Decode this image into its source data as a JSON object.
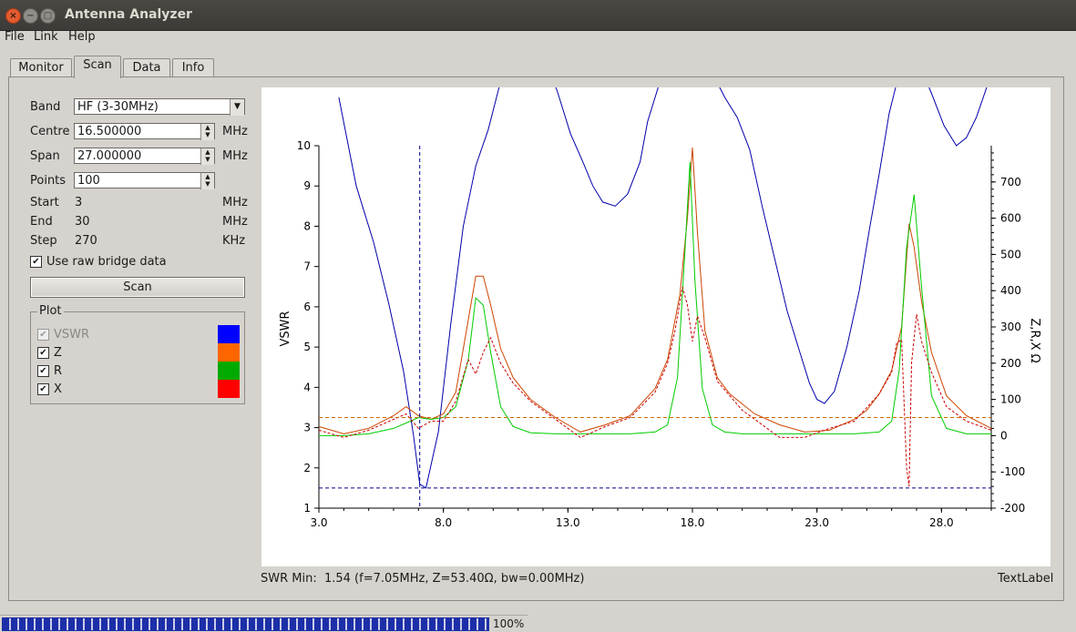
{
  "window": {
    "title": "Antenna Analyzer",
    "close_glyph": "×",
    "min_glyph": "−",
    "max_glyph": "□"
  },
  "menu": [
    "File",
    "Link",
    "Help"
  ],
  "tabs": [
    "Monitor",
    "Scan",
    "Data",
    "Info"
  ],
  "active_tab": "Scan",
  "form": {
    "band_label": "Band",
    "band_value": "HF (3-30MHz)",
    "centre_label": "Centre",
    "centre_value": "16.500000",
    "centre_unit": "MHz",
    "span_label": "Span",
    "span_value": "27.000000",
    "span_unit": "MHz",
    "points_label": "Points",
    "points_value": "100",
    "start_label": "Start",
    "start_value": "3",
    "start_unit": "MHz",
    "end_label": "End",
    "end_value": "30",
    "end_unit": "MHz",
    "step_label": "Step",
    "step_value": "270",
    "step_unit": "KHz",
    "raw_label": "Use raw bridge data",
    "raw_checked": true,
    "scan_button": "Scan"
  },
  "plot_group": {
    "title": "Plot",
    "items": [
      {
        "label": "VSWR",
        "checked": true,
        "disabled": true,
        "color": "#0000ff"
      },
      {
        "label": "Z",
        "checked": true,
        "disabled": false,
        "color": "#ff6600"
      },
      {
        "label": "R",
        "checked": true,
        "disabled": false,
        "color": "#00aa00"
      },
      {
        "label": "X",
        "checked": true,
        "disabled": false,
        "color": "#ff0000"
      }
    ]
  },
  "chart_data": {
    "type": "line",
    "xlabel": "",
    "ylabel_left": "VSWR",
    "ylabel_right": "Z,R,X Ω",
    "xlim": [
      3,
      30
    ],
    "ylim_left": [
      1,
      10
    ],
    "ylim_right": [
      -200,
      800
    ],
    "x_ticks": [
      "3.0",
      "8.0",
      "13.0",
      "18.0",
      "23.0",
      "28.0"
    ],
    "y_left_ticks": [
      "1",
      "2",
      "3",
      "4",
      "5",
      "6",
      "7",
      "8",
      "9",
      "10"
    ],
    "y_right_ticks": [
      "-200",
      "-100",
      "0",
      "100",
      "200",
      "300",
      "400",
      "500",
      "600",
      "700"
    ],
    "series": [
      {
        "name": "VSWR",
        "axis": "left",
        "color": "#0000aa",
        "dash": false,
        "x": [
          3.8,
          4.5,
          5.2,
          5.8,
          6.4,
          6.8,
          7.05,
          7.3,
          7.8,
          8.3,
          8.8,
          9.3,
          9.8,
          10.3,
          10.8,
          11.3,
          11.7,
          12.2,
          12.6,
          13.1,
          13.6,
          14.0,
          14.4,
          14.9,
          15.4,
          15.9,
          16.2,
          16.8,
          17.4,
          17.9,
          18.3,
          18.8,
          19.3,
          19.8,
          20.3,
          20.8,
          21.3,
          21.8,
          22.3,
          22.7,
          23.0,
          23.3,
          23.7,
          24.2,
          24.7,
          25.1,
          25.5,
          25.9,
          26.3,
          26.8,
          27.2,
          27.6,
          28.1,
          28.6,
          29.0,
          29.4,
          29.9
        ],
        "y": [
          11.2,
          9.0,
          7.6,
          6.1,
          4.4,
          2.8,
          1.6,
          1.5,
          2.9,
          5.6,
          8.0,
          9.5,
          10.4,
          11.6,
          12.3,
          12.6,
          12.4,
          12.0,
          11.3,
          10.3,
          9.6,
          9.0,
          8.6,
          8.5,
          8.8,
          9.6,
          10.6,
          11.8,
          12.3,
          12.5,
          12.4,
          11.8,
          11.2,
          10.7,
          9.9,
          8.5,
          7.2,
          5.9,
          4.9,
          4.1,
          3.7,
          3.6,
          3.9,
          5.0,
          6.4,
          7.9,
          9.3,
          10.8,
          11.8,
          12.2,
          11.9,
          11.3,
          10.5,
          10.0,
          10.2,
          10.7,
          11.6
        ]
      },
      {
        "name": "Z",
        "axis": "right",
        "color": "#cc4400",
        "dash": false,
        "x": [
          3.0,
          4.0,
          5.0,
          6.0,
          6.5,
          7.0,
          7.5,
          8.0,
          8.5,
          9.0,
          9.3,
          9.6,
          9.9,
          10.3,
          10.8,
          11.5,
          12.5,
          13.5,
          14.5,
          15.5,
          16.5,
          17.0,
          17.5,
          17.8,
          18.0,
          18.2,
          18.5,
          19.0,
          19.5,
          20.5,
          21.5,
          22.5,
          23.5,
          24.5,
          25.0,
          25.5,
          26.0,
          26.4,
          26.7,
          26.9,
          27.2,
          27.6,
          28.2,
          29.0,
          30.0
        ],
        "y": [
          25,
          5,
          20,
          55,
          80,
          55,
          45,
          60,
          120,
          320,
          440,
          440,
          360,
          240,
          160,
          100,
          50,
          10,
          30,
          55,
          130,
          210,
          390,
          600,
          795,
          560,
          290,
          160,
          115,
          60,
          30,
          10,
          15,
          45,
          70,
          115,
          180,
          300,
          585,
          520,
          370,
          230,
          110,
          55,
          20
        ]
      },
      {
        "name": "R",
        "axis": "right",
        "color": "#00cc00",
        "dash": false,
        "x": [
          3.0,
          4.0,
          5.0,
          6.0,
          6.5,
          7.0,
          7.5,
          8.0,
          8.5,
          9.0,
          9.3,
          9.6,
          9.9,
          10.3,
          10.8,
          11.5,
          12.5,
          13.5,
          14.5,
          15.5,
          16.5,
          17.0,
          17.4,
          17.7,
          17.9,
          18.1,
          18.4,
          18.8,
          19.3,
          20.0,
          21.5,
          22.5,
          23.5,
          24.5,
          25.5,
          26.0,
          26.3,
          26.6,
          26.9,
          27.2,
          27.6,
          28.2,
          29.0,
          30.0
        ],
        "y": [
          0,
          0,
          5,
          20,
          35,
          50,
          45,
          50,
          80,
          210,
          380,
          360,
          230,
          80,
          25,
          8,
          5,
          5,
          5,
          5,
          10,
          30,
          160,
          510,
          755,
          430,
          130,
          30,
          10,
          5,
          5,
          5,
          5,
          5,
          10,
          40,
          180,
          520,
          665,
          410,
          110,
          20,
          5,
          5
        ]
      },
      {
        "name": "X",
        "axis": "right",
        "color": "#cc0000",
        "dash": true,
        "x": [
          3.0,
          4.0,
          5.0,
          6.0,
          6.5,
          7.0,
          7.5,
          8.0,
          8.5,
          9.0,
          9.3,
          9.6,
          9.9,
          10.3,
          10.8,
          11.5,
          12.5,
          13.5,
          14.5,
          15.5,
          16.5,
          17.0,
          17.3,
          17.6,
          17.8,
          18.0,
          18.2,
          18.5,
          19.0,
          20.0,
          21.5,
          22.5,
          23.5,
          24.5,
          25.5,
          26.0,
          26.2,
          26.4,
          26.6,
          26.7,
          26.8,
          27.0,
          27.2,
          27.6,
          28.2,
          29.0,
          30.0
        ],
        "y": [
          15,
          -5,
          15,
          45,
          60,
          20,
          40,
          40,
          95,
          210,
          170,
          230,
          270,
          200,
          145,
          95,
          45,
          -5,
          25,
          50,
          120,
          200,
          290,
          410,
          360,
          260,
          330,
          270,
          150,
          70,
          -5,
          -5,
          20,
          40,
          115,
          175,
          255,
          265,
          -90,
          -140,
          200,
          335,
          260,
          175,
          80,
          40,
          15
        ]
      }
    ],
    "markers": {
      "vline_x": 7.05,
      "hline_left": 1.5,
      "hline_right": 50
    }
  },
  "status": {
    "swr_label": "SWR Min:",
    "swr_value": "1.54 (f=7.05MHz, Z=53.40Ω, bw=0.00MHz)",
    "text_label": "TextLabel"
  },
  "progress": {
    "percent_text": "100%",
    "value": 1.0
  }
}
